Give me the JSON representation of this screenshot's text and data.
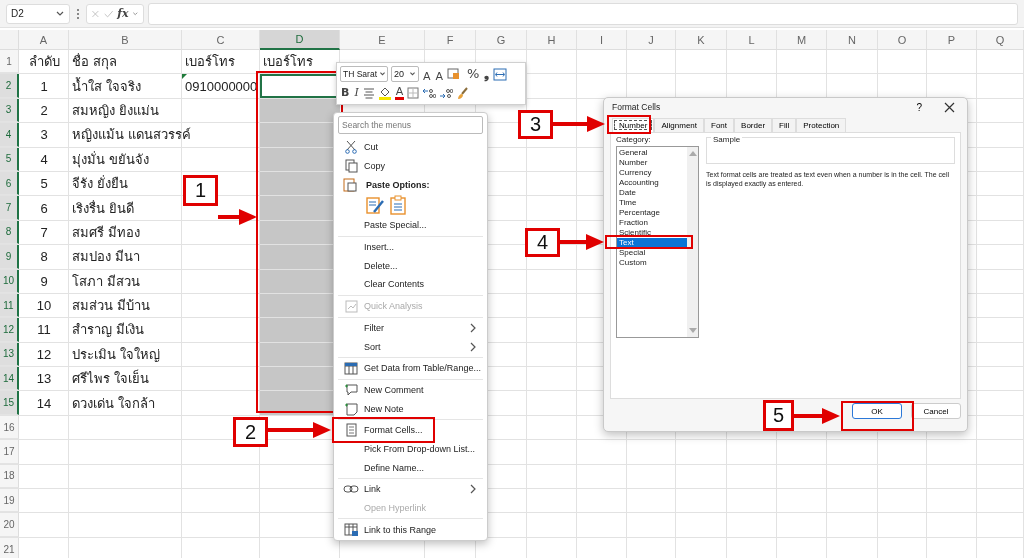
{
  "formula_bar": {
    "name_box": "D2",
    "function_label": "fx"
  },
  "columns": [
    {
      "label": "A",
      "selected": false
    },
    {
      "label": "B",
      "selected": false
    },
    {
      "label": "C",
      "selected": false
    },
    {
      "label": "D",
      "selected": true
    },
    {
      "label": "E",
      "selected": false
    },
    {
      "label": "F",
      "selected": false
    },
    {
      "label": "G",
      "selected": false
    },
    {
      "label": "H",
      "selected": false
    },
    {
      "label": "I",
      "selected": false
    },
    {
      "label": "J",
      "selected": false
    },
    {
      "label": "K",
      "selected": false
    },
    {
      "label": "L",
      "selected": false
    },
    {
      "label": "M",
      "selected": false
    },
    {
      "label": "N",
      "selected": false
    },
    {
      "label": "O",
      "selected": false
    },
    {
      "label": "P",
      "selected": false
    },
    {
      "label": "Q",
      "selected": false
    }
  ],
  "rows": [
    {
      "number": "1",
      "selected": false,
      "a": "ลำดับ",
      "b": "ชื่อ สกุล",
      "c": "เบอร์โทร",
      "d": "เบอร์โทร"
    },
    {
      "number": "2",
      "selected": true,
      "a": "1",
      "b": "น้ำใส ใจจริง",
      "c": "0910000000"
    },
    {
      "number": "3",
      "selected": true,
      "a": "2",
      "b": "สมหญิง ยิงแม่น"
    },
    {
      "number": "4",
      "selected": true,
      "a": "3",
      "b": "หญิงแม้น แดนสวรรค์"
    },
    {
      "number": "5",
      "selected": true,
      "a": "4",
      "b": "มุ่งมั่น ขยันจัง"
    },
    {
      "number": "6",
      "selected": true,
      "a": "5",
      "b": "จีรัง ยั่งยืน"
    },
    {
      "number": "7",
      "selected": true,
      "a": "6",
      "b": "เริงรื่น ยินดี"
    },
    {
      "number": "8",
      "selected": true,
      "a": "7",
      "b": "สมศรี มีทอง"
    },
    {
      "number": "9",
      "selected": true,
      "a": "8",
      "b": "สมปอง มีนา"
    },
    {
      "number": "10",
      "selected": true,
      "a": "9",
      "b": "โสภา มีสวน"
    },
    {
      "number": "11",
      "selected": true,
      "a": "10",
      "b": "สมส่วน มีบ้าน"
    },
    {
      "number": "12",
      "selected": true,
      "a": "11",
      "b": "สำราญ มีเงิน"
    },
    {
      "number": "13",
      "selected": true,
      "a": "12",
      "b": "ประเมิน ใจใหญ่"
    },
    {
      "number": "14",
      "selected": true,
      "a": "13",
      "b": "ศรีไพร ใจเย็น"
    },
    {
      "number": "15",
      "selected": true,
      "a": "14",
      "b": "ดวงเด่น ใจกล้า"
    },
    {
      "number": "16",
      "selected": false
    },
    {
      "number": "17",
      "selected": false
    },
    {
      "number": "18",
      "selected": false
    },
    {
      "number": "19",
      "selected": false
    },
    {
      "number": "20",
      "selected": false
    },
    {
      "number": "21",
      "selected": false
    }
  ],
  "mini_toolbar": {
    "font": "TH Sarat",
    "size": "20",
    "row_1": [
      {
        "kind": "grow",
        "label": "A"
      },
      {
        "kind": "shrink",
        "label": "A"
      },
      {
        "kind": "format"
      },
      {
        "kind": "percent",
        "label": "%"
      },
      {
        "kind": "comma",
        "label": "❟"
      },
      {
        "kind": "wrap"
      }
    ],
    "row_2": [
      {
        "kind": "bold",
        "label": "B"
      },
      {
        "kind": "italic",
        "label": "I"
      },
      {
        "kind": "align"
      },
      {
        "kind": "fill"
      },
      {
        "kind": "fontcolor",
        "label": "A"
      },
      {
        "kind": "border"
      },
      {
        "kind": "inc"
      },
      {
        "kind": "dec"
      },
      {
        "kind": "brush"
      }
    ]
  },
  "context_menu": {
    "search": {
      "placeholder": "Search the menus"
    },
    "items": [
      {
        "kind": "item",
        "label": "Cut",
        "disabled": false,
        "submenu": false
      },
      {
        "kind": "item",
        "label": "Copy",
        "disabled": false,
        "submenu": false
      },
      {
        "kind": "header",
        "label": "Paste Options:"
      },
      {
        "kind": "paste-row"
      },
      {
        "kind": "item",
        "label": "Paste Special...",
        "disabled": false,
        "submenu": false
      },
      {
        "kind": "separator"
      },
      {
        "kind": "item",
        "label": "Insert...",
        "disabled": false,
        "submenu": false
      },
      {
        "kind": "item",
        "label": "Delete...",
        "disabled": false,
        "submenu": false
      },
      {
        "kind": "item",
        "label": "Clear Contents",
        "disabled": false,
        "submenu": false
      },
      {
        "kind": "separator"
      },
      {
        "kind": "item",
        "label": "Quick Analysis",
        "disabled": true,
        "submenu": false
      },
      {
        "kind": "separator"
      },
      {
        "kind": "item",
        "label": "Filter",
        "disabled": false,
        "submenu": true
      },
      {
        "kind": "item",
        "label": "Sort",
        "disabled": false,
        "submenu": true
      },
      {
        "kind": "separator"
      },
      {
        "kind": "item",
        "label": "Get Data from Table/Range...",
        "disabled": false,
        "submenu": false
      },
      {
        "kind": "separator"
      },
      {
        "kind": "item",
        "label": "New Comment",
        "disabled": false,
        "submenu": false
      },
      {
        "kind": "item",
        "label": "New Note",
        "disabled": false,
        "submenu": false
      },
      {
        "kind": "separator"
      },
      {
        "kind": "item",
        "label": "Format Cells...",
        "disabled": false,
        "submenu": false
      },
      {
        "kind": "item",
        "label": "Pick From Drop-down List...",
        "disabled": false,
        "submenu": false
      },
      {
        "kind": "item",
        "label": "Define Name...",
        "disabled": false,
        "submenu": false
      },
      {
        "kind": "separator"
      },
      {
        "kind": "item",
        "label": "Link",
        "disabled": false,
        "submenu": true
      },
      {
        "kind": "item",
        "label": "Open Hyperlink",
        "disabled": true,
        "submenu": false
      },
      {
        "kind": "separator"
      },
      {
        "kind": "item",
        "label": "Link to this Range",
        "disabled": false,
        "submenu": false
      }
    ]
  },
  "dialog": {
    "title": "Format Cells",
    "help": "?",
    "tabs": [
      {
        "label": "Number",
        "selected": true
      },
      {
        "label": "Alignment",
        "selected": false
      },
      {
        "label": "Font",
        "selected": false
      },
      {
        "label": "Border",
        "selected": false
      },
      {
        "label": "Fill",
        "selected": false
      },
      {
        "label": "Protection",
        "selected": false
      }
    ],
    "category_label": "Category:",
    "categories": [
      {
        "label": "General",
        "selected": false
      },
      {
        "label": "Number",
        "selected": false
      },
      {
        "label": "Currency",
        "selected": false
      },
      {
        "label": "Accounting",
        "selected": false
      },
      {
        "label": "Date",
        "selected": false
      },
      {
        "label": "Time",
        "selected": false
      },
      {
        "label": "Percentage",
        "selected": false
      },
      {
        "label": "Fraction",
        "selected": false
      },
      {
        "label": "Scientific",
        "selected": false
      },
      {
        "label": "Text",
        "selected": true
      },
      {
        "label": "Special",
        "selected": false
      },
      {
        "label": "Custom",
        "selected": false
      }
    ],
    "sample_label": "Sample",
    "description": "Text format cells are treated as text even when a number is in the cell. The cell is displayed exactly as entered.",
    "buttons": [
      {
        "label": "OK",
        "default": true
      },
      {
        "label": "Cancel",
        "default": false
      }
    ]
  },
  "annotations": [
    {
      "number": "1"
    },
    {
      "number": "2"
    },
    {
      "number": "3"
    },
    {
      "number": "4"
    },
    {
      "number": "5"
    }
  ]
}
